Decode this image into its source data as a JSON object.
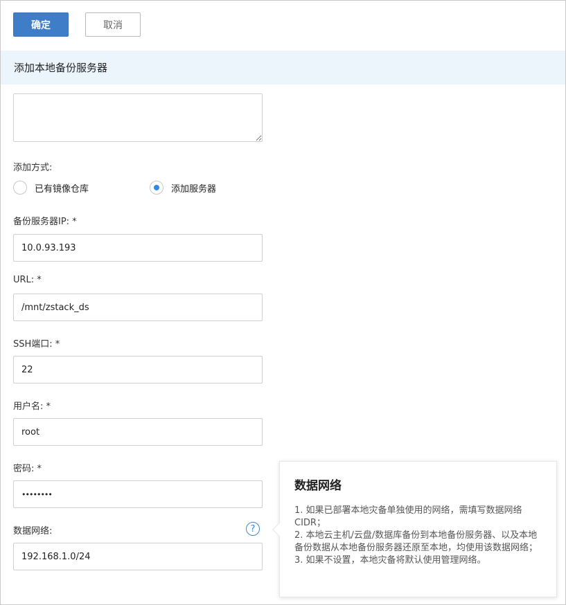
{
  "toolbar": {
    "confirm_label": "确定",
    "cancel_label": "取消"
  },
  "section": {
    "title": "添加本地备份服务器"
  },
  "description": {
    "value": ""
  },
  "add_method": {
    "label": "添加方式:",
    "options": [
      {
        "label": "已有镜像仓库",
        "selected": false
      },
      {
        "label": "添加服务器",
        "selected": true
      }
    ]
  },
  "fields": {
    "ip": {
      "label": "备份服务器IP: *",
      "value": "10.0.93.193"
    },
    "url": {
      "label": "URL: *",
      "value": "/mnt/zstack_ds"
    },
    "ssh_port": {
      "label": "SSH端口: *",
      "value": "22"
    },
    "username": {
      "label": "用户名: *",
      "value": "root"
    },
    "password": {
      "label": "密码: *",
      "value": "••••••••"
    },
    "data_network": {
      "label": "数据网络:",
      "value": "192.168.1.0/24"
    }
  },
  "tooltip": {
    "title": "数据网络",
    "lines": [
      "1. 如果已部署本地灾备单独使用的网络，需填写数据网络CIDR；",
      "2. 本地云主机/云盘/数据库备份到本地备份服务器、以及本地备份数据从本地备份服务器还原至本地，均使用该数据网络；",
      "3. 如果不设置，本地灾备将默认使用管理网络。"
    ]
  },
  "colors": {
    "primary": "#3f7dc8",
    "header_bg": "#edf5fc",
    "radio_selected": "#2e8ae6"
  }
}
